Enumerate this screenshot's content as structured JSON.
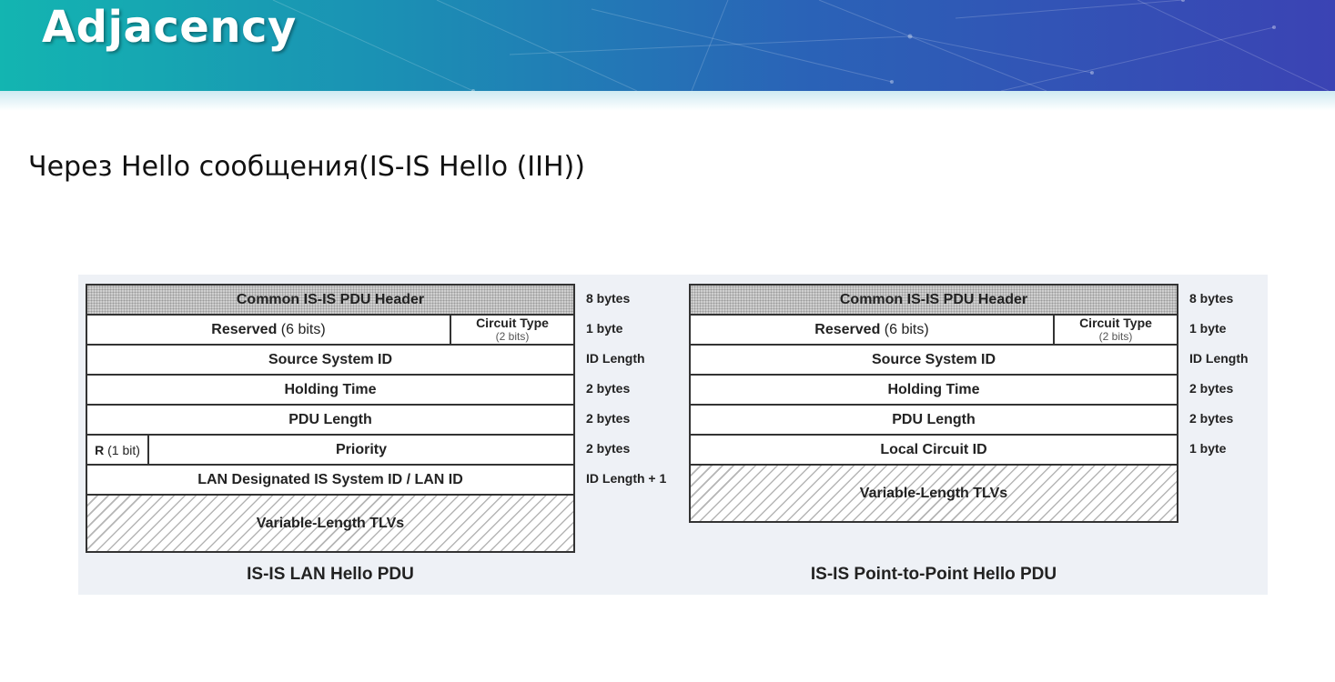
{
  "slide": {
    "title": "Adjacency",
    "subtitle": "Через Hello сообщения(IS-IS Hello (IIH))"
  },
  "lan": {
    "caption": "IS-IS LAN Hello PDU",
    "header": "Common IS-IS PDU Header",
    "reserved_label": "Reserved",
    "reserved_bits": "(6 bits)",
    "circuit_type": "Circuit Type",
    "circuit_type_bits": "(2 bits)",
    "source_system_id": "Source System ID",
    "holding_time": "Holding Time",
    "pdu_length": "PDU Length",
    "r_label": "R",
    "r_bits": "(1 bit)",
    "priority": "Priority",
    "lan_id": "LAN Designated IS System ID / LAN ID",
    "tlvs": "Variable-Length TLVs",
    "sizes": [
      "8 bytes",
      "1 byte",
      "ID Length",
      "2 bytes",
      "2 bytes",
      "2 bytes",
      "ID Length + 1"
    ]
  },
  "p2p": {
    "caption": "IS-IS Point-to-Point Hello PDU",
    "header": "Common IS-IS PDU Header",
    "reserved_label": "Reserved",
    "reserved_bits": "(6 bits)",
    "circuit_type": "Circuit Type",
    "circuit_type_bits": "(2 bits)",
    "source_system_id": "Source System ID",
    "holding_time": "Holding Time",
    "pdu_length": "PDU Length",
    "local_circuit_id": "Local Circuit ID",
    "tlvs": "Variable-Length TLVs",
    "sizes": [
      "8 bytes",
      "1 byte",
      "ID Length",
      "2 bytes",
      "2 bytes",
      "1 byte"
    ]
  }
}
